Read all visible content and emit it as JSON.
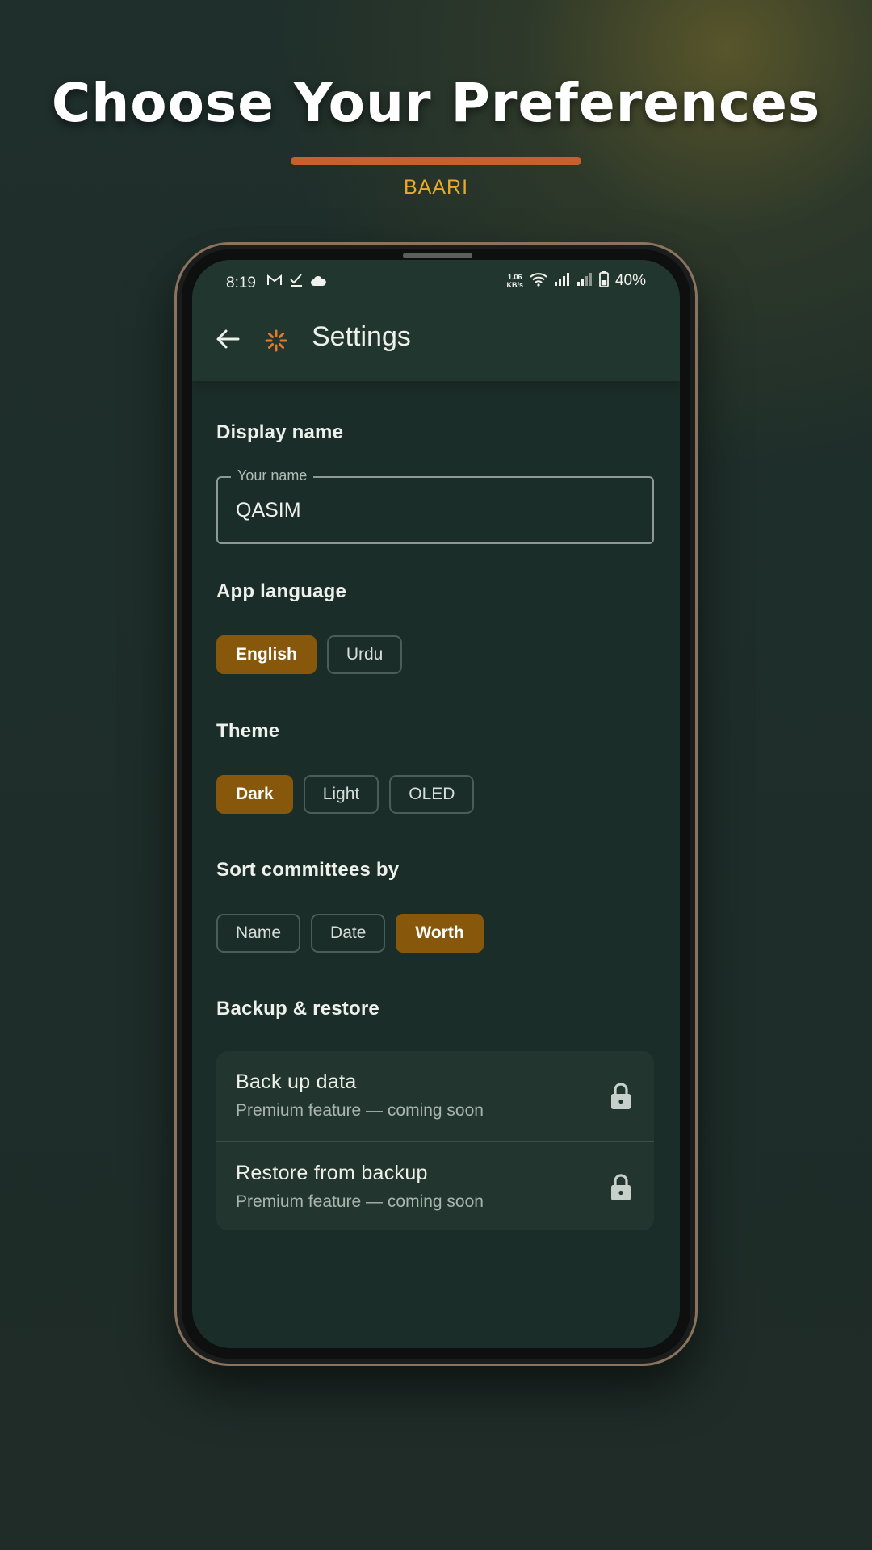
{
  "headline": "Choose Your Preferences",
  "brand": "BAARI",
  "colors": {
    "accent_bar": "#c8602e",
    "brand_text": "#e9a92a",
    "chip_selected": "#87580b"
  },
  "status_bar": {
    "time": "8:19",
    "left_icons": [
      "gmail-icon",
      "task-check-icon",
      "cloud-icon"
    ],
    "net_speed_value": "1.06",
    "net_speed_unit": "KB/s",
    "right_icons": [
      "wifi-icon",
      "signal-icon",
      "signal-icon",
      "battery-icon"
    ],
    "battery": "40%"
  },
  "app_bar": {
    "back_icon": "back-arrow-icon",
    "logo_icon": "app-logo-icon",
    "title": "Settings"
  },
  "display_name": {
    "section_title": "Display name",
    "field_label": "Your name",
    "value": "QASIM"
  },
  "language": {
    "section_title": "App language",
    "options": [
      {
        "label": "English",
        "selected": true
      },
      {
        "label": "Urdu",
        "selected": false
      }
    ]
  },
  "theme": {
    "section_title": "Theme",
    "options": [
      {
        "label": "Dark",
        "selected": true
      },
      {
        "label": "Light",
        "selected": false
      },
      {
        "label": "OLED",
        "selected": false
      }
    ]
  },
  "sort": {
    "section_title": "Sort committees by",
    "options": [
      {
        "label": "Name",
        "selected": false
      },
      {
        "label": "Date",
        "selected": false
      },
      {
        "label": "Worth",
        "selected": true
      }
    ]
  },
  "backup": {
    "section_title": "Backup & restore",
    "items": [
      {
        "title": "Back up data",
        "subtitle": "Premium feature — coming soon",
        "icon": "lock-icon"
      },
      {
        "title": "Restore from backup",
        "subtitle": "Premium feature — coming soon",
        "icon": "lock-icon"
      }
    ]
  }
}
